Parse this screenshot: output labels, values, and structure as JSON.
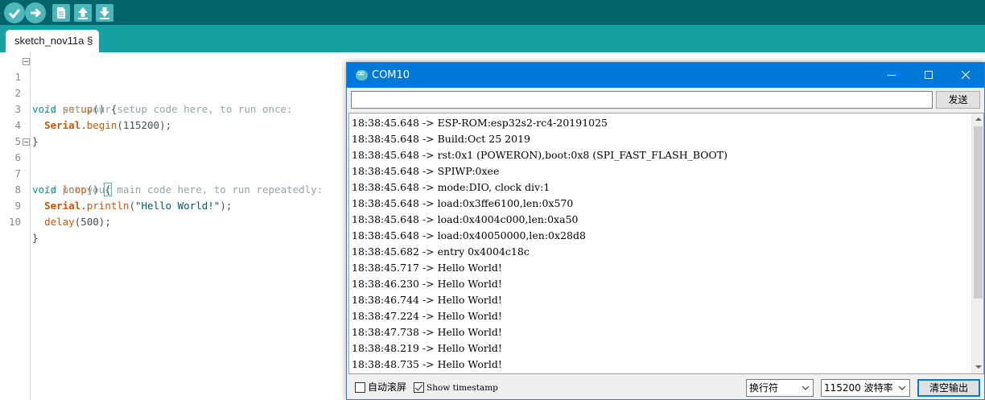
{
  "ide": {
    "toolbar": {
      "verify_icon": "check-icon",
      "upload_icon": "arrow-right-icon",
      "new_icon": "new-file-icon",
      "open_icon": "arrow-up-icon",
      "save_icon": "arrow-down-icon"
    },
    "tab": {
      "label": "sketch_nov11a §"
    },
    "code": {
      "line_numbers": [
        "1",
        "2",
        "3",
        "4",
        "5",
        "6",
        "7",
        "8",
        "9",
        "10"
      ],
      "l1": {
        "type": "void",
        "fn": "setup",
        "rest": "() {"
      },
      "l2": {
        "comment": "  // put your setup code here, to run once:"
      },
      "l3": {
        "indent": "  ",
        "cls": "Serial",
        "dot": ".",
        "fn": "begin",
        "rest": "(115200);"
      },
      "l4": {
        "text": "}"
      },
      "l6": {
        "type": "void",
        "fn": "loop",
        "mid": "() ",
        "brace": "{"
      },
      "l7": {
        "comment": "  // put your main code here, to run repeatedly:"
      },
      "l8": {
        "indent": "  ",
        "cls": "Serial",
        "dot": ".",
        "fn": "println",
        "open": "(",
        "str": "\"Hello World!\"",
        "rest": ");"
      },
      "l9": {
        "indent": "  ",
        "fn": "delay",
        "rest": "(500);"
      },
      "l10": {
        "text": "}"
      }
    }
  },
  "monitor": {
    "title": "COM10",
    "minimize": "—",
    "send_input_value": "",
    "send_label": "发送",
    "lines": [
      "18:38:45.648 -> ESP-ROM:esp32s2-rc4-20191025",
      "18:38:45.648 -> Build:Oct 25 2019",
      "18:38:45.648 -> rst:0x1 (POWERON),boot:0x8 (SPI_FAST_FLASH_BOOT)",
      "18:38:45.648 -> SPIWP:0xee",
      "18:38:45.648 -> mode:DIO, clock div:1",
      "18:38:45.648 -> load:0x3ffe6100,len:0x570",
      "18:38:45.648 -> load:0x4004c000,len:0xa50",
      "18:38:45.648 -> load:0x40050000,len:0x28d8",
      "18:38:45.682 -> entry 0x4004c18c",
      "18:38:45.717 -> Hello World!",
      "18:38:46.230 -> Hello World!",
      "18:38:46.744 -> Hello World!",
      "18:38:47.224 -> Hello World!",
      "18:38:47.738 -> Hello World!",
      "18:38:48.219 -> Hello World!",
      "18:38:48.735 -> Hello World!"
    ],
    "autoscroll": {
      "label": "自动滚屏",
      "checked": false
    },
    "timestamp": {
      "label": "Show timestamp",
      "checked": true
    },
    "line_ending": {
      "selected": "换行符"
    },
    "baud": {
      "selected": "115200 波特率"
    },
    "clear_label": "清空输出"
  }
}
